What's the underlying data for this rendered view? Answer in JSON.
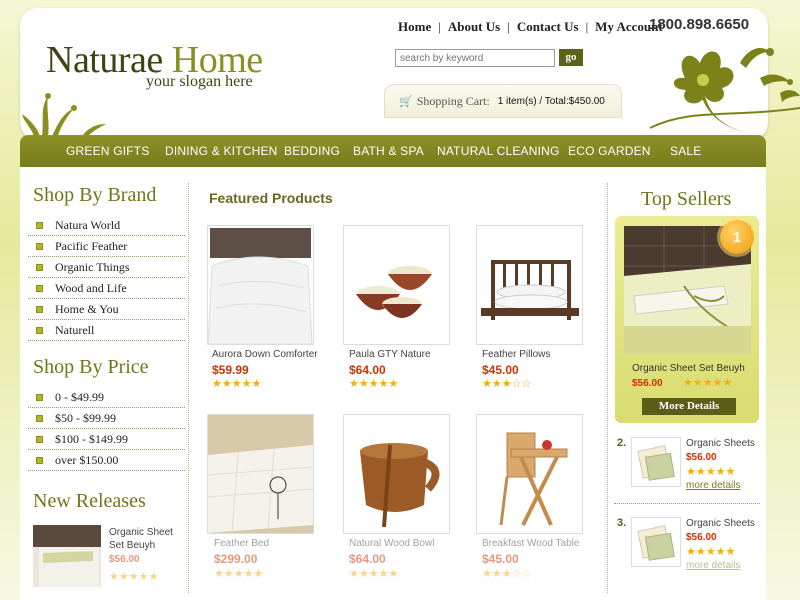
{
  "logo": {
    "word1": "Naturae",
    "word2": "Home",
    "slogan": "your slogan here"
  },
  "top_links": [
    "Home",
    "About Us",
    "Contact Us",
    "My Account"
  ],
  "phone": "1800.898.6650",
  "search": {
    "placeholder": "search by keyword",
    "button": "go"
  },
  "cart": {
    "label": "Shopping Cart:",
    "summary": "1 item(s) / Total:$450.00"
  },
  "nav": [
    "GREEN GIFTS",
    "DINING & KITCHEN",
    "BEDDING",
    "BATH & SPA",
    "NATURAL CLEANING",
    "ECO GARDEN",
    "SALE"
  ],
  "brand": {
    "heading": "Shop By Brand",
    "items": [
      "Natura World",
      "Pacific Feather",
      "Organic Things",
      "Wood and Life",
      "Home & You",
      "Naturell"
    ]
  },
  "price": {
    "heading": "Shop By Price",
    "items": [
      "0 - $49.99",
      "$50 - $99.99",
      "$100 - $149.99",
      "over $150.00"
    ]
  },
  "new_releases": {
    "heading": "New Releases",
    "item": {
      "name": "Organic Sheet Set Beuyh",
      "price": "$56.00",
      "rating": 5
    }
  },
  "featured": {
    "heading": "Featured Products",
    "products": [
      {
        "name": "Aurora Down Comforter",
        "price": "$59.99",
        "rating": 5
      },
      {
        "name": "Paula GTY Nature",
        "price": "$64.00",
        "rating": 5
      },
      {
        "name": "Feather Pillows",
        "price": "$45.00",
        "rating": 3
      },
      {
        "name": "Feather Bed",
        "price": "$299.00",
        "rating": 5
      },
      {
        "name": "Natural Wood Bowl",
        "price": "$64.00",
        "rating": 5
      },
      {
        "name": "Breakfast Wood Table",
        "price": "$45.00",
        "rating": 3
      }
    ]
  },
  "top_sellers": {
    "heading": "Top Sellers",
    "first": {
      "rank": "1",
      "name": "Organic Sheet Set Beuyh",
      "price": "$56.00",
      "rating": 5,
      "button": "More Details"
    },
    "list": [
      {
        "rank": "2.",
        "name": "Organic Sheets",
        "price": "$56.00",
        "rating": 5,
        "link": "more details"
      },
      {
        "rank": "3.",
        "name": "Organic Sheets",
        "price": "$56.00",
        "rating": 5,
        "link": "more details"
      }
    ]
  },
  "colors": {
    "olive": "#7f8320",
    "price_red": "#cc3300",
    "star": "#f2ad16"
  }
}
